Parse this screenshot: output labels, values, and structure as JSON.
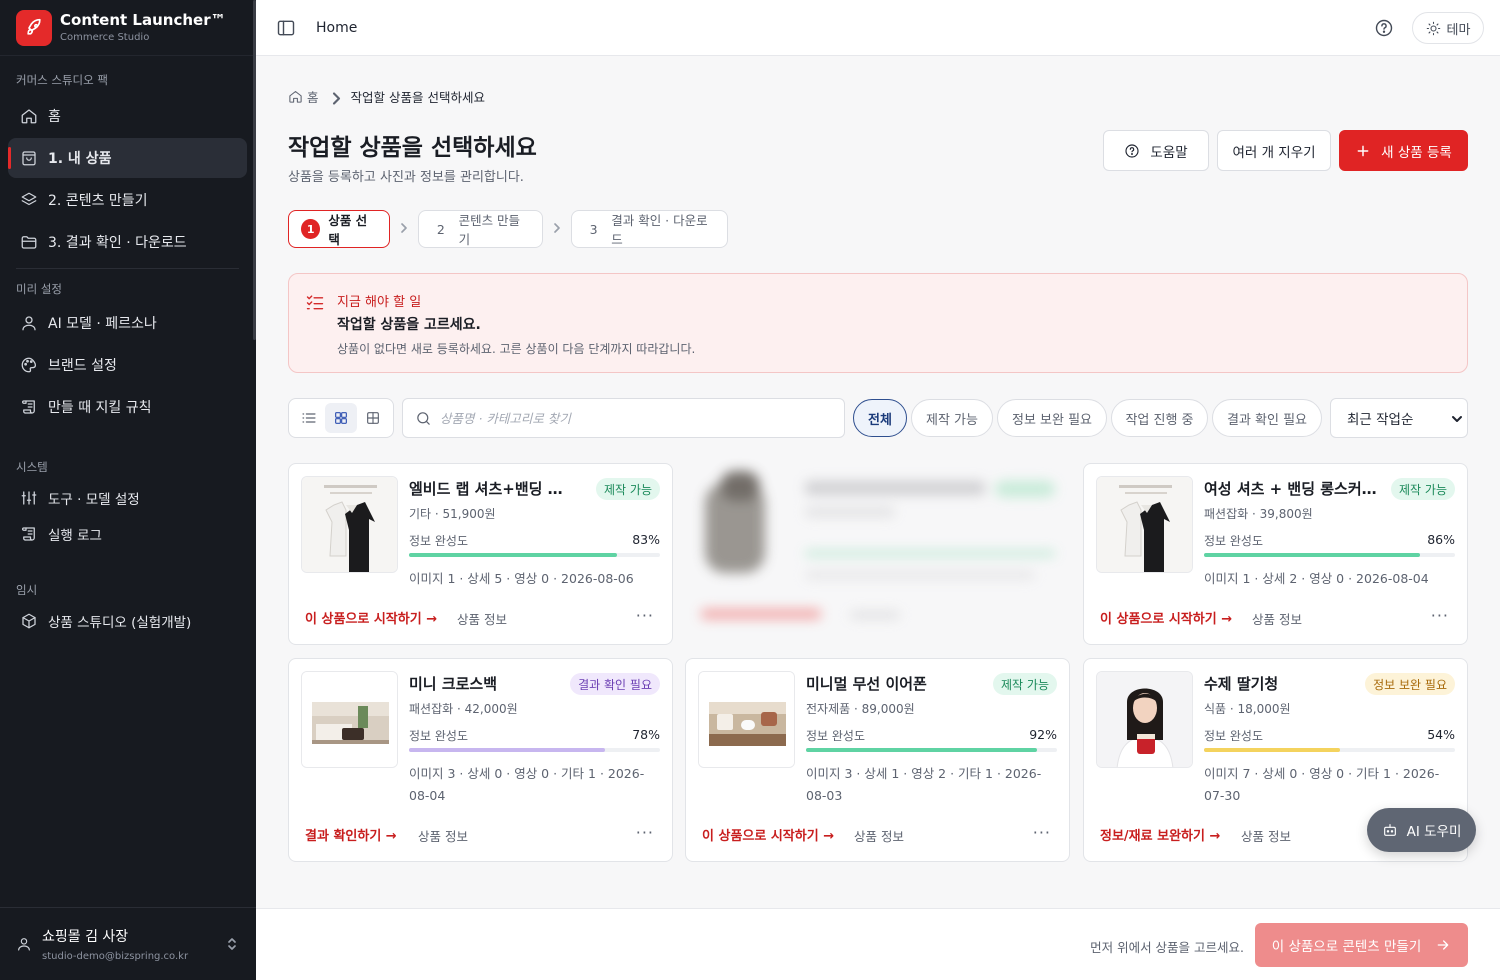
{
  "sidebar": {
    "brand_name": "Content Launcher™",
    "brand_sub": "Commerce Studio",
    "sections": {
      "pack": "커머스 스튜디오 팩",
      "preset": "미리 설정",
      "system": "시스템",
      "temp": "임시"
    },
    "items": {
      "home": "홈",
      "my_products": "1. 내 상품",
      "make_content": "2. 콘텐츠 만들기",
      "results": "3. 결과 확인 · 다운로드",
      "ai_model": "AI 모델 · 페르소나",
      "brand": "브랜드 설정",
      "rules": "만들 때 지킬 규칙",
      "tools": "도구 · 모델 설정",
      "logs": "실행 로그",
      "studio": "상품 스튜디오 (실험개발)"
    },
    "user": {
      "name": "쇼핑몰 김 사장",
      "email": "studio-demo@bizspring.co.kr"
    }
  },
  "topbar": {
    "title": "Home",
    "theme_label": "테마"
  },
  "breadcrumb": {
    "home": "홈",
    "current": "작업할 상품을 선택하세요"
  },
  "page": {
    "title": "작업할 상품을 선택하세요",
    "subtitle": "상품을 등록하고 사진과 정보를 관리합니다."
  },
  "actions": {
    "help": "도움말",
    "clear_many": "여러 개 지우기",
    "new_product": "새 상품 등록"
  },
  "steps": [
    {
      "num": "1",
      "label": "상품 선택"
    },
    {
      "num": "2",
      "label": "콘텐츠 만들기"
    },
    {
      "num": "3",
      "label": "결과 확인 · 다운로드"
    }
  ],
  "alert": {
    "title": "지금 해야 할 일",
    "heading": "작업할 상품을 고르세요.",
    "desc": "상품이 없다면 새로 등록하세요. 고른 상품이 다음 단계까지 따라갑니다."
  },
  "search": {
    "placeholder": "상품명 · 카테고리로 찾기"
  },
  "filters": [
    "전체",
    "제작 가능",
    "정보 보완 필요",
    "작업 진행 중",
    "결과 확인 필요"
  ],
  "sort": {
    "selected": "최근 작업순"
  },
  "colors": {
    "accent": "#e02424",
    "progress_green": "#5fd3a3",
    "progress_purple": "#c7b6ef",
    "progress_yellow": "#f4d35e"
  },
  "products": [
    {
      "name": "엘비드 랩 셔츠+밴딩 롱스...",
      "badge": "제작 가능",
      "meta": "기타 · 51,900원",
      "label": "정보 완성도",
      "pct": "83%",
      "progress": 0.83,
      "stats": "이미지 1 · 상세 5 · 영상 0 · 2026-08-06",
      "action": "이 상품으로 시작하기 →",
      "info": "상품 정보",
      "thumb_icon": "dress-set-image"
    },
    {
      "name": "여성 셔츠 + 밴딩 롱스커트 ...",
      "badge": "제작 가능",
      "meta": "패션잡화 · 39,800원",
      "label": "정보 완성도",
      "pct": "86%",
      "progress": 0.86,
      "stats": "이미지 1 · 상세 2 · 영상 0 · 2026-08-04",
      "action": "이 상품으로 시작하기 →",
      "info": "상품 정보",
      "thumb_icon": "dress-set-image"
    },
    {
      "name": "미니 크로스백",
      "badge": "결과 확인 필요",
      "meta": "패션잡화 · 42,000원",
      "label": "정보 완성도",
      "pct": "78%",
      "progress": 0.78,
      "stats": "이미지 3 · 상세 0 · 영상 0 · 기타 1 · 2026-08-04",
      "action": "결과 확인하기 →",
      "info": "상품 정보",
      "thumb_icon": "room-image"
    },
    {
      "name": "미니멀 무선 이어폰",
      "badge": "제작 가능",
      "meta": "전자제품 · 89,000원",
      "label": "정보 완성도",
      "pct": "92%",
      "progress": 0.92,
      "stats": "이미지 3 · 상세 1 · 영상 2 · 기타 1 · 2026-08-03",
      "action": "이 상품으로 시작하기 →",
      "info": "상품 정보",
      "thumb_icon": "desk-image"
    },
    {
      "name": "수제 딸기청",
      "badge": "정보 보완 필요",
      "meta": "식품 · 18,000원",
      "label": "정보 완성도",
      "pct": "54%",
      "progress": 0.54,
      "stats": "이미지 7 · 상세 0 · 영상 0 · 기타 1 · 2026-07-30",
      "action": "정보/재료 보완하기 →",
      "info": "상품 정보",
      "thumb_icon": "model-holding-jar-image"
    }
  ],
  "footer": {
    "hint": "먼저 위에서 상품을 고르세요.",
    "cta": "이 상품으로 콘텐츠 만들기"
  },
  "ai_helper": "AI 도우미"
}
